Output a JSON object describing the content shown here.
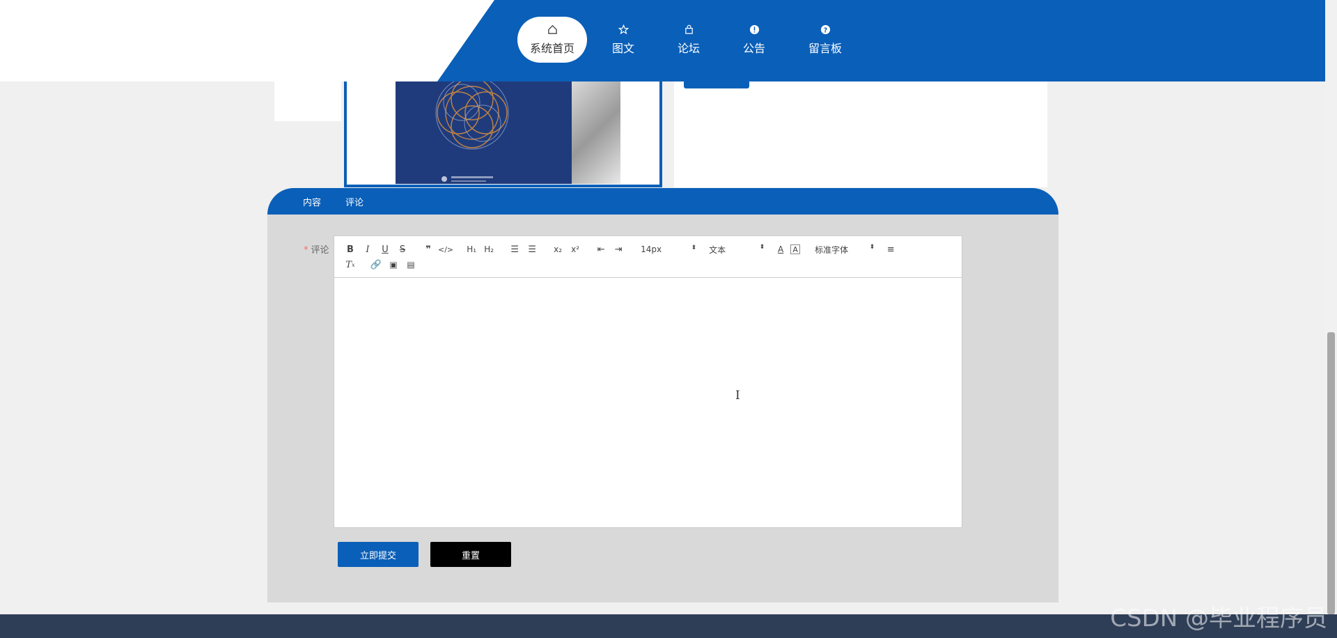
{
  "nav": {
    "items": [
      {
        "label": "系统首页",
        "icon": "home-icon",
        "active": true
      },
      {
        "label": "图文",
        "icon": "star-icon",
        "active": false
      },
      {
        "label": "论坛",
        "icon": "bag-icon",
        "active": false
      },
      {
        "label": "公告",
        "icon": "alert-icon",
        "active": false
      },
      {
        "label": "留言板",
        "icon": "help-icon",
        "active": false
      }
    ]
  },
  "tabs": [
    {
      "label": "内容"
    },
    {
      "label": "评论"
    }
  ],
  "form": {
    "label": "评论",
    "required_mark": "*",
    "toolbar": {
      "font_size": "14px",
      "heading": "文本",
      "font_family": "标准字体"
    },
    "submit_label": "立即提交",
    "reset_label": "重置"
  },
  "watermark": "CSDN @毕业程序员",
  "colors": {
    "brand": "#0a5fb8",
    "form_bg": "#d9d9d9",
    "footer": "#2f3e57"
  }
}
